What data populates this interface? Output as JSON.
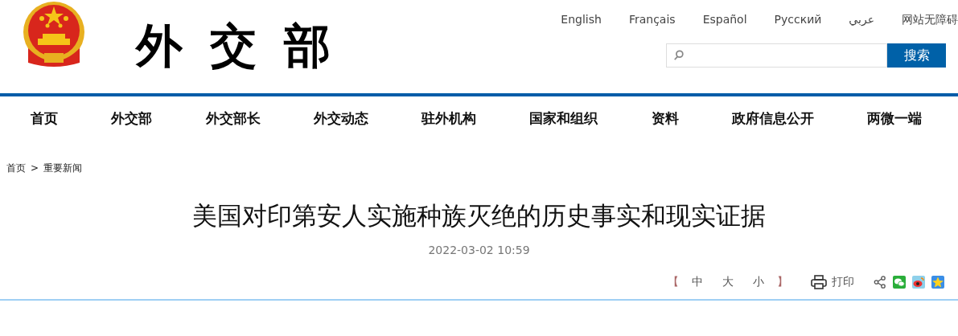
{
  "logo": {
    "text": "外交部"
  },
  "languages": [
    "English",
    "Français",
    "Español",
    "Русский",
    "عربي",
    "网站无障碍"
  ],
  "search": {
    "button": "搜索"
  },
  "nav": [
    "首页",
    "外交部",
    "外交部长",
    "外交动态",
    "驻外机构",
    "国家和组织",
    "资料",
    "政府信息公开",
    "两微一端"
  ],
  "breadcrumb": {
    "items": [
      "首页",
      "重要新闻"
    ],
    "separator": ">"
  },
  "article": {
    "title": "美国对印第安人实施种族灭绝的历史事实和现实证据",
    "date": "2022-03-02 10:59"
  },
  "tools": {
    "open_bracket": "【",
    "sizes": [
      "中",
      "大",
      "小"
    ],
    "close_bracket": "】",
    "print": "打印"
  }
}
